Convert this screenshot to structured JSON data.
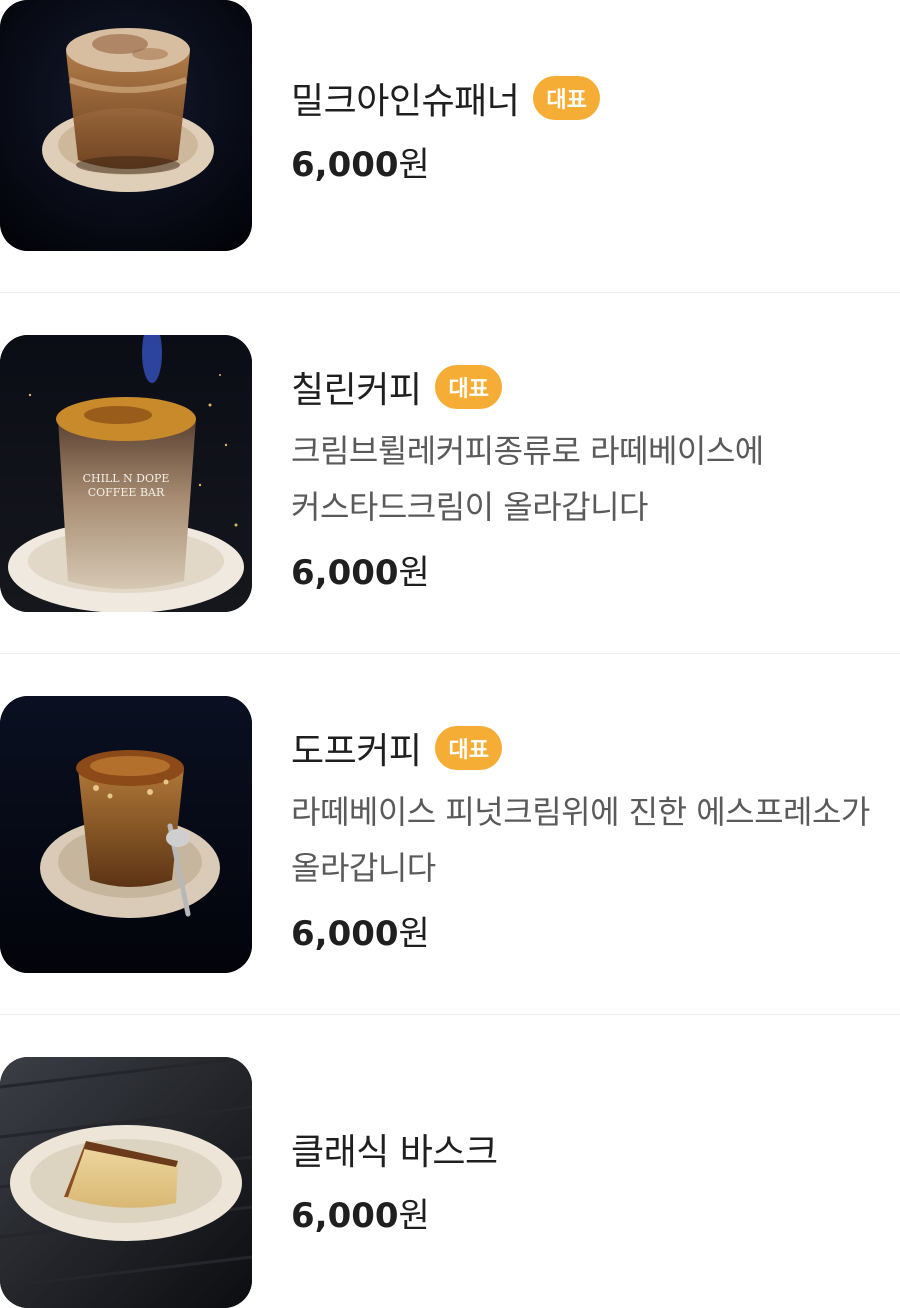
{
  "menu": {
    "items": [
      {
        "name": "밀크아인슈패너",
        "badge": "대표",
        "description": "",
        "price": "6,000",
        "price_unit": "원",
        "image_icon": "einspanner-photo"
      },
      {
        "name": "칠린커피",
        "badge": "대표",
        "description": "크림브륄레커피종류로 라떼베이스에 커스타드크림이 올라갑니다",
        "price": "6,000",
        "price_unit": "원",
        "image_icon": "creme-brulee-coffee-photo",
        "image_caption_line1": "CHILL N DOPE",
        "image_caption_line2": "COFFEE BAR"
      },
      {
        "name": "도프커피",
        "badge": "대표",
        "description": "라떼베이스 피넛크림위에 진한 에스프레소가 올라갑니다",
        "price": "6,000",
        "price_unit": "원",
        "image_icon": "dope-coffee-photo"
      },
      {
        "name": "클래식 바스크",
        "badge": "",
        "description": "",
        "price": "6,000",
        "price_unit": "원",
        "image_icon": "basque-cheesecake-photo"
      }
    ]
  },
  "colors": {
    "badge": "#f6ad35",
    "title": "#1f1f1f",
    "description": "#5a5a5a",
    "divider": "#ececec"
  }
}
